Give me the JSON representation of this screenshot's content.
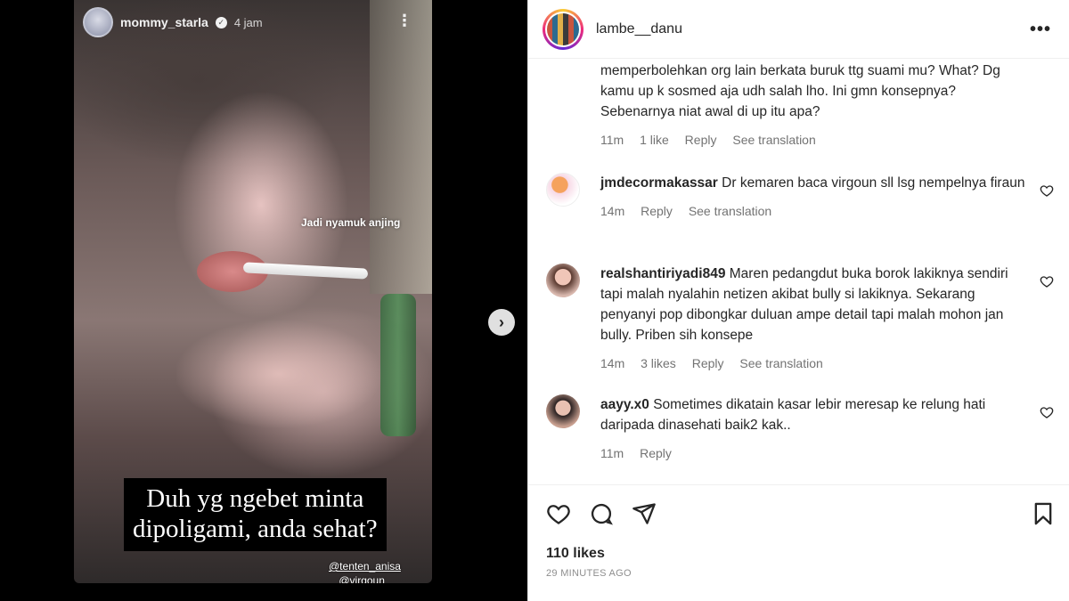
{
  "story": {
    "username": "mommy_starla",
    "time": "4 jam",
    "sticker_text": "Jadi nyamuk anjing",
    "caption_line1": "Duh yg ngebet minta",
    "caption_line2": "dipoligami, anda sehat?",
    "tag1": "@tenten_anisa",
    "tag2": "@virgoun_"
  },
  "post": {
    "username": "lambe__danu",
    "likes": "110 likes",
    "time_ago": "29 MINUTES AGO"
  },
  "comments": [
    {
      "user": "",
      "text": "memperbolehkan org lain berkata buruk ttg suami mu? What? Dg kamu up k sosmed aja udh salah lho. Ini gmn konsepnya? Sebenarnya niat awal di up itu apa?",
      "time": "11m",
      "likes": "1 like",
      "reply": "Reply",
      "translate": "See translation"
    },
    {
      "user": "jmdecormakassar",
      "text": "Dr kemaren baca virgoun sll lsg nempelnya firaun",
      "time": "14m",
      "likes": "",
      "reply": "Reply",
      "translate": "See translation"
    },
    {
      "user": "realshantiriyadi849",
      "text": "Maren pedangdut buka borok lakiknya sendiri tapi malah nyalahin netizen akibat bully si lakiknya. Sekarang penyanyi pop dibongkar duluan ampe detail tapi malah mohon jan bully. Priben sih konsepe",
      "time": "14m",
      "likes": "3 likes",
      "reply": "Reply",
      "translate": "See translation"
    },
    {
      "user": "aayy.x0",
      "text": "Sometimes dikatain kasar lebir meresap ke relung hati daripada dinasehati baik2 kak..",
      "time": "11m",
      "likes": "",
      "reply": "Reply",
      "translate": ""
    }
  ],
  "icons": {
    "like": "heart-icon",
    "comment": "comment-icon",
    "share": "share-icon",
    "save": "bookmark-icon",
    "next": "chevron-right-icon",
    "more": "more-options-icon"
  }
}
